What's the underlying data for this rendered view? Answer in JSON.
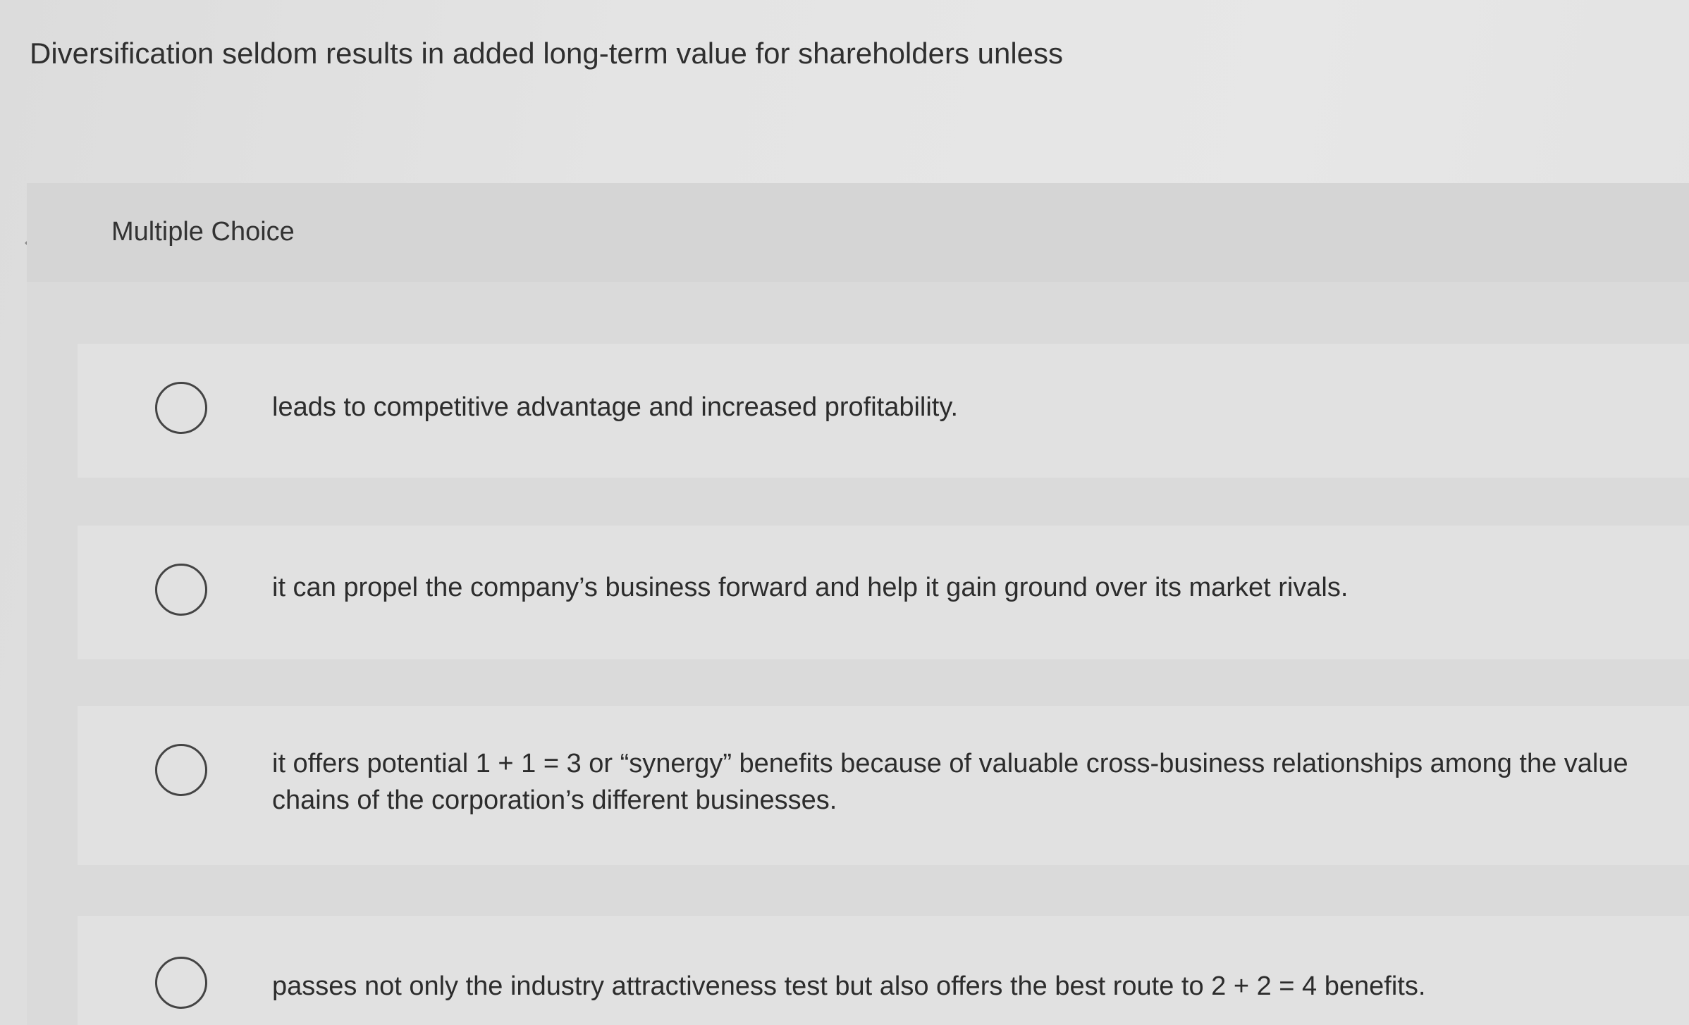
{
  "question": {
    "text": "Diversification seldom results in added long-term value for shareholders unless"
  },
  "panel": {
    "type_label": "Multiple Choice"
  },
  "options": [
    {
      "text": "leads to competitive advantage and increased profitability."
    },
    {
      "text": "it can propel the company’s business forward and help it gain ground over its market rivals."
    },
    {
      "text": "it offers potential 1 + 1 = 3 or “synergy” benefits because of valuable cross-business relationships among the value chains of the corporation’s different businesses."
    },
    {
      "text": "passes not only the industry attractiveness test but also offers the best route to 2 + 2 = 4 benefits."
    }
  ],
  "colors": {
    "background": "#e4e4e4",
    "panel": "#dadada",
    "text": "#2b2b2b"
  }
}
